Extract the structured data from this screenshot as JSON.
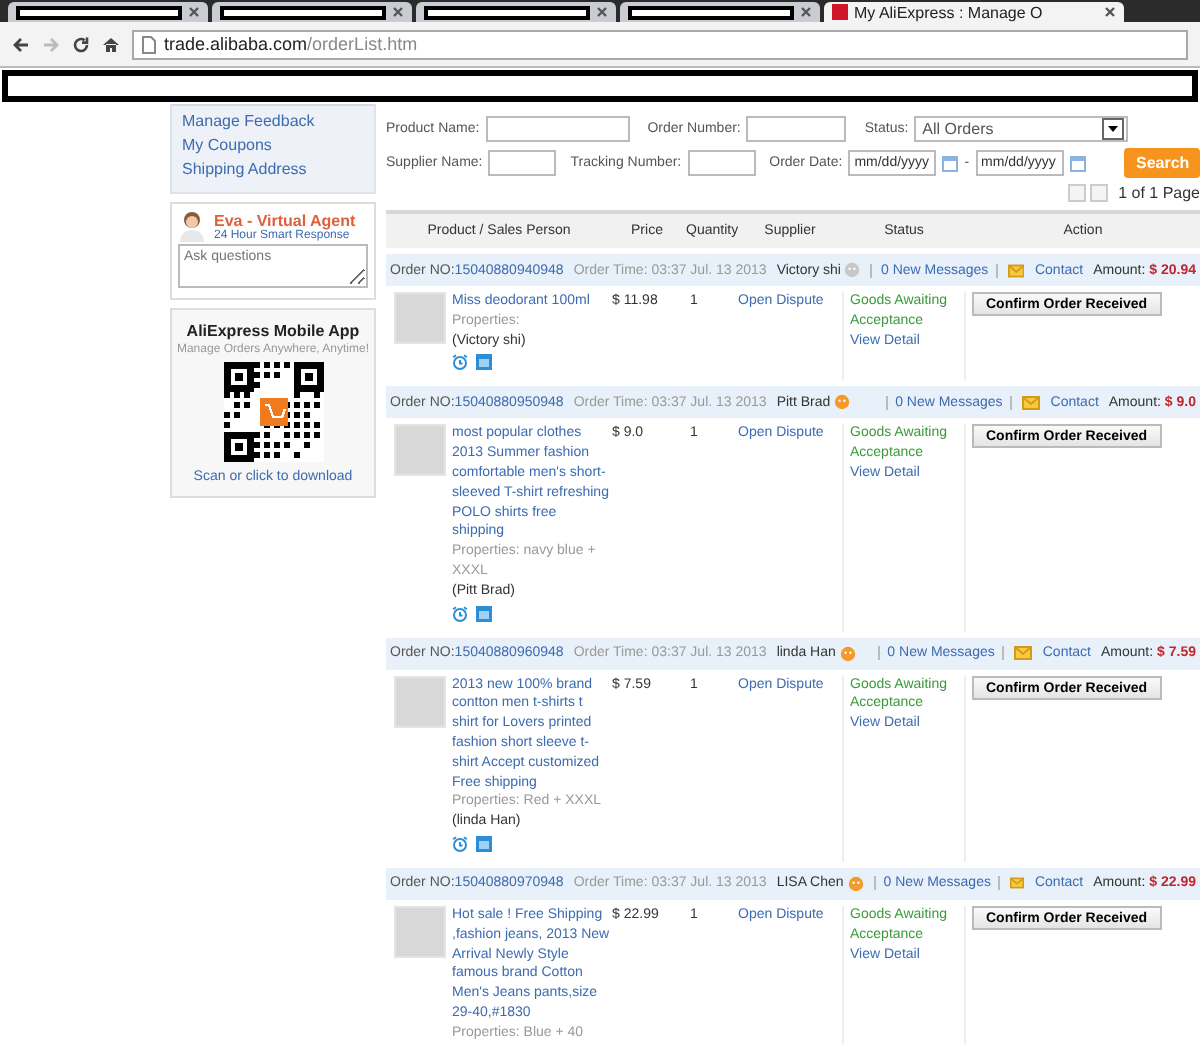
{
  "browser": {
    "tabs": [
      {
        "redacted": true,
        "selected": false
      },
      {
        "redacted": true,
        "selected": false
      },
      {
        "redacted": true,
        "selected": false
      },
      {
        "redacted": true,
        "selected": false
      },
      {
        "title": "My AliExpress : Manage O",
        "redacted": false,
        "selected": true
      }
    ],
    "url_host": "trade.alibaba.com",
    "url_path": "/orderList.htm"
  },
  "sidebar": {
    "links": [
      "Manage Feedback",
      "My Coupons",
      "Shipping Address"
    ],
    "agent": {
      "name": "Eva - Virtual Agent",
      "subtitle": "24 Hour Smart Response",
      "placeholder": "Ask questions"
    },
    "app": {
      "title": "AliExpress Mobile App",
      "subtitle": "Manage Orders Anywhere, Anytime!",
      "link": "Scan or click to download"
    }
  },
  "filters": {
    "product_name": "Product Name:",
    "order_number": "Order Number:",
    "status_label": "Status:",
    "status_value": "All Orders",
    "supplier_name": "Supplier Name:",
    "tracking_number": "Tracking Number:",
    "order_date": "Order Date:",
    "date_from": {
      "placeholder": "mm/dd/yyyy"
    },
    "date_to": {
      "placeholder": "mm/dd/yyyy"
    },
    "date_sep": "-",
    "search": "Search"
  },
  "pager": "1 of 1 Page",
  "table": {
    "columns": [
      "Product / Sales Person",
      "Price",
      "Quantity",
      "Supplier",
      "Status",
      "Action"
    ],
    "orders": [
      {
        "order_label": "Order NO:",
        "order_no": "15040880940948",
        "time": "Order Time: 03:37 Jul. 13 2013",
        "supplier": "Victory shi",
        "supplier_online": false,
        "messages": "0 New Messages",
        "contact": "Contact",
        "amount_label": "Amount:",
        "amount": "$ 20.94",
        "item": {
          "title": "Miss deodorant 100ml",
          "price": "$ 11.98",
          "qty": "1",
          "properties": "Properties:",
          "buyer": "(Victory shi)",
          "dispute": "Open Dispute",
          "status": "Goods Awaiting Acceptance",
          "detail": "View Detail",
          "action": "Confirm Order Received"
        }
      },
      {
        "order_label": "Order NO:",
        "order_no": "15040880950948",
        "time": "Order Time: 03:37 Jul. 13 2013",
        "supplier": "Pitt Brad",
        "supplier_online": true,
        "messages": "0 New Messages",
        "contact": "Contact",
        "amount_label": "Amount:",
        "amount": "$ 9.0",
        "item": {
          "title": "most popular clothes 2013 Summer fashion comfortable men's short-sleeved T-shirt refreshing POLO shirts free shipping",
          "price": "$ 9.0",
          "qty": "1",
          "properties": "Properties: navy blue  + XXXL",
          "buyer": "(Pitt Brad)",
          "dispute": "Open Dispute",
          "status": "Goods Awaiting Acceptance",
          "detail": "View Detail",
          "action": "Confirm Order Received"
        }
      },
      {
        "order_label": "Order NO:",
        "order_no": "15040880960948",
        "time": "Order Time: 03:37 Jul. 13 2013",
        "supplier": "linda Han",
        "supplier_online": true,
        "messages": "0 New Messages",
        "contact": "Contact",
        "amount_label": "Amount:",
        "amount": "$ 7.59",
        "item": {
          "title": "2013 new 100% brand contton men t-shirts t shirt for Lovers printed fashion short sleeve t-shirt Accept customized Free shipping",
          "price": "$ 7.59",
          "qty": "1",
          "properties": "Properties: Red  + XXXL",
          "buyer": "(linda Han)",
          "dispute": "Open Dispute",
          "status": "Goods Awaiting Acceptance",
          "detail": "View Detail",
          "action": "Confirm Order Received"
        }
      },
      {
        "order_label": "Order NO:",
        "order_no": "15040880970948",
        "time": "Order Time: 03:37 Jul. 13 2013",
        "supplier": "LISA Chen",
        "supplier_online": true,
        "messages": "0 New Messages",
        "contact": "Contact",
        "amount_label": "Amount:",
        "amount": "$ 22.99",
        "item": {
          "title": "Hot sale ! Free Shipping ,fashion jeans, 2013 New Arrival Newly Style famous brand Cotton Men's Jeans pants,size 29-40,#1830",
          "price": "$ 22.99",
          "qty": "1",
          "properties": "Properties: Blue  + 40",
          "dispute": "Open Dispute",
          "status": "Goods Awaiting Acceptance",
          "detail": "View Detail",
          "action": "Confirm Order Received"
        }
      }
    ]
  }
}
